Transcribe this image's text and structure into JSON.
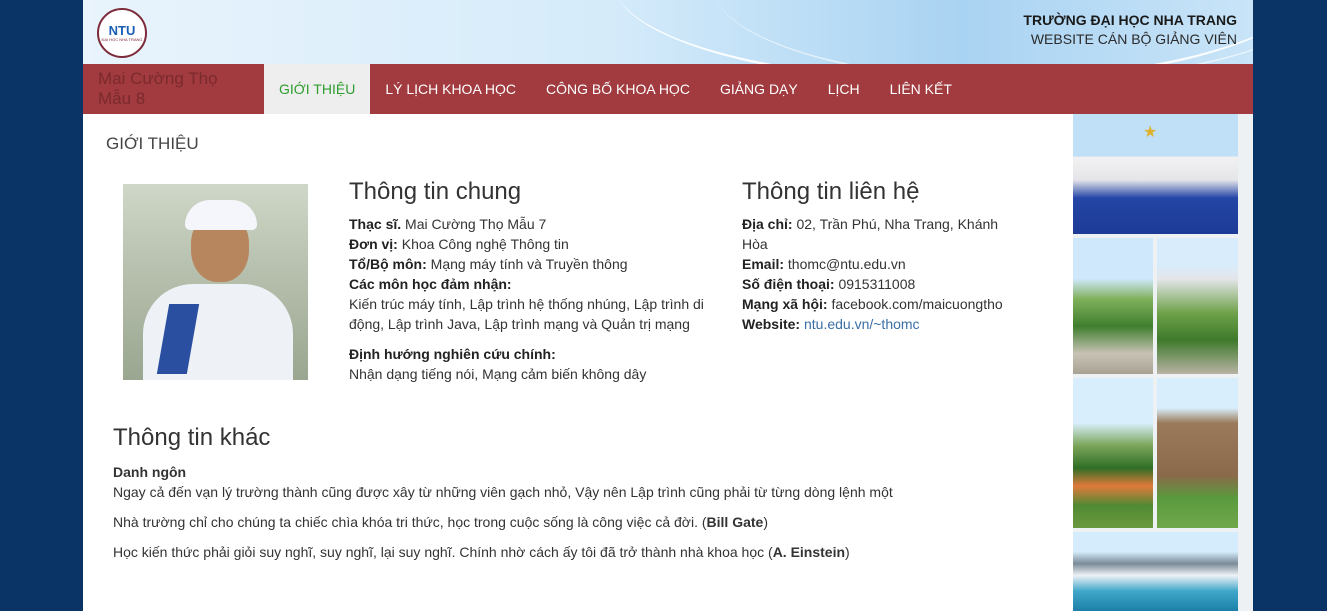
{
  "header": {
    "logo_text": "NTU",
    "logo_sub": "ĐẠI HỌC NHA TRANG",
    "school_name": "TRƯỜNG ĐẠI HỌC NHA TRANG",
    "site_title": "WEBSITE CÁN BỘ GIẢNG VIÊN"
  },
  "nav": {
    "brand": "Mai Cường Thọ Mẫu 8",
    "items": [
      {
        "label": "GIỚI THIỆU",
        "active": true
      },
      {
        "label": "LÝ LỊCH KHOA HỌC"
      },
      {
        "label": "CÔNG BỐ KHOA HỌC"
      },
      {
        "label": "GIẢNG DẠY"
      },
      {
        "label": "LỊCH"
      },
      {
        "label": "LIÊN KẾT"
      }
    ]
  },
  "section_title": "GIỚI THIỆU",
  "general": {
    "heading": "Thông tin chung",
    "degree_label": "Thạc sĩ.",
    "degree_value": " Mai Cường Thọ Mẫu 7",
    "unit_label": "Đơn vị:",
    "unit_value": " Khoa Công nghệ Thông tin",
    "dept_label": "Tổ/Bộ môn:",
    "dept_value": " Mạng máy tính và Truyền thông",
    "courses_label": "Các môn học đảm nhận:",
    "courses_value": "Kiến trúc máy tính, Lập trình hệ thống nhúng, Lập trình di động, Lập trình Java, Lập trình mạng và Quản trị mạng",
    "research_label": "Định hướng nghiên cứu chính:",
    "research_value": "Nhận dạng tiếng nói, Mạng cảm biến không dây"
  },
  "contact": {
    "heading": "Thông tin liên hệ",
    "address_label": "Địa chỉ:",
    "address_value": " 02, Trần Phú, Nha Trang, Khánh Hòa",
    "email_label": "Email:",
    "email_value": " thomc@ntu.edu.vn",
    "phone_label": "Số điện thoại:",
    "phone_value": " 0915311008",
    "social_label": "Mạng xã hội:",
    "social_value": " facebook.com/maicuongtho",
    "website_label": "Website:",
    "website_value": "ntu.edu.vn/~thomc"
  },
  "other": {
    "heading": "Thông tin khác",
    "quotes_label": "Danh ngôn",
    "quote1": "Ngay cả đến vạn lý trường thành cũng được xây từ những viên gạch nhỏ, Vậy nên Lập trình cũng phải từ từng dòng lệnh một",
    "quote2_text": "Nhà trường chỉ cho chúng ta chiếc chìa khóa tri thức, học trong cuộc sống là công việc cả đời. (",
    "quote2_author": "Bill Gate",
    "quote2_end": ")",
    "quote3_text": " Học kiến thức phải giỏi suy nghĩ, suy nghĩ, lại suy nghĩ. Chính nhờ cách ấy tôi đã trở thành nhà khoa học (",
    "quote3_author": "A. Einstein",
    "quote3_end": ")"
  },
  "colors": {
    "background": "#0b3466",
    "navbar": "#a13b3f",
    "active_tab_text": "#2e9c2e",
    "link": "#3a6ea5"
  }
}
